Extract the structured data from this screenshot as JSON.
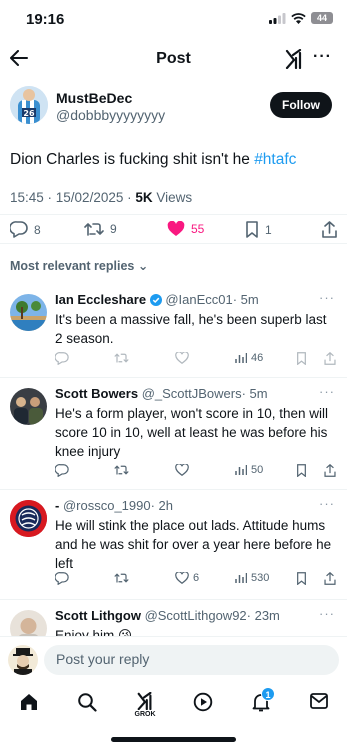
{
  "status_bar": {
    "time": "19:16",
    "battery": "44"
  },
  "nav": {
    "title": "Post"
  },
  "tweet": {
    "author_name": "MustBeDec",
    "author_handle": "@dobbbyyyyyyyy",
    "follow_label": "Follow",
    "text": "Dion Charles is fucking shit isn't he ",
    "hashtag": "#htafc",
    "timestamp": "15:45 · 15/02/2025 · ",
    "views_count": "5K",
    "views_label": " Views",
    "replies": "8",
    "reposts": "9",
    "likes": "55",
    "bookmarks": "1"
  },
  "sort_label": "Most relevant replies",
  "replies": [
    {
      "name": "Ian Eccleshare",
      "handle": "@IanEcc01",
      "time": "· 5m",
      "text": "It's been a massive fall, he's been superb last 2 season.",
      "views": "46"
    },
    {
      "name": "Scott Bowers",
      "handle": "@_ScottJBowers",
      "time": "· 5m",
      "text": "He's a form player, won't score in 10, then will score 10 in 10, well at least he was before his knee injury",
      "views": "50"
    },
    {
      "name": "-",
      "handle": "@rossco_1990",
      "time": "· 2h",
      "text": "He will stink the place out lads. Attitude hums and he was shit for over a year here before he left",
      "likes": "6",
      "views": "530"
    },
    {
      "name": "Scott Lithgow",
      "handle": "@ScottLithgow92",
      "time": "· 23m",
      "text": "Enjoy him 😘"
    }
  ],
  "composer": {
    "placeholder": "Post your reply"
  },
  "tabbar": {
    "grok_label": "GROK",
    "notifications_badge": "1"
  },
  "colors": {
    "accent": "#1d9bf0",
    "like": "#f91880",
    "text": "#0f1419",
    "secondary": "#536471"
  }
}
